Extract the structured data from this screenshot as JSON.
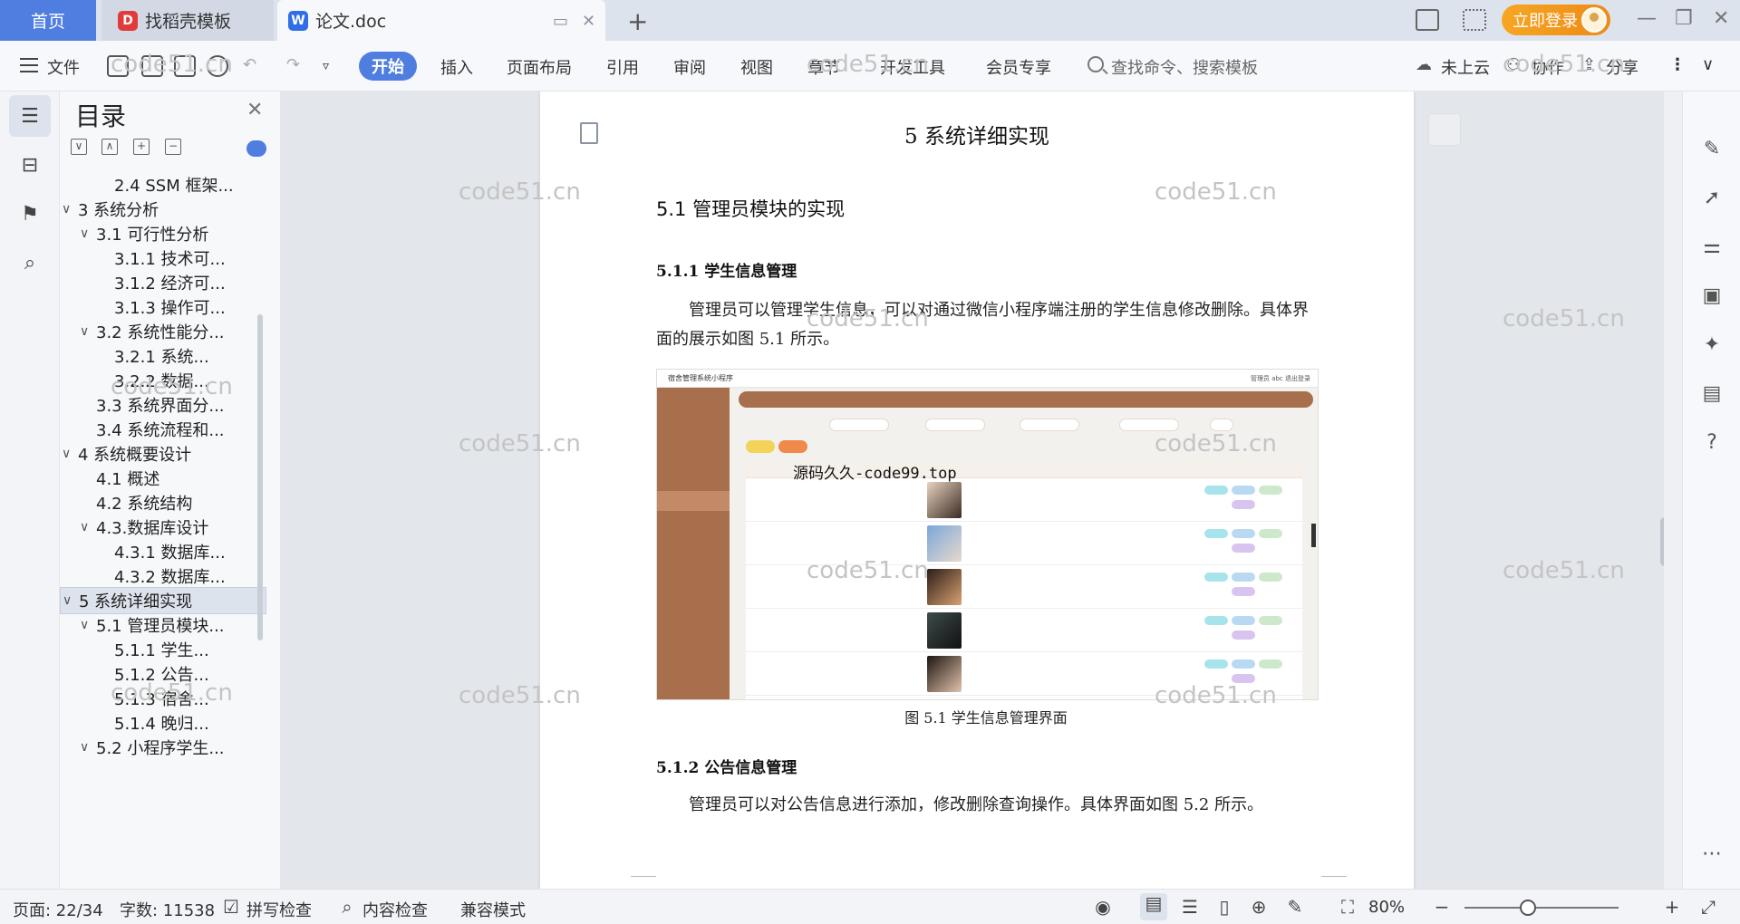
{
  "tabs": {
    "home": "首页",
    "template": "找稻壳模板",
    "doc": "论文.doc",
    "new_tab": "+"
  },
  "account": {
    "login": "立即登录"
  },
  "toolbar": {
    "file": "文件",
    "start": "开始",
    "menus": [
      "插入",
      "页面布局",
      "引用",
      "审阅",
      "视图",
      "章节",
      "开发工具",
      "会员专享"
    ],
    "search_placeholder": "查找命令、搜索模板",
    "cloud": "未上云",
    "collab": "协作",
    "share": "分享"
  },
  "toc": {
    "title": "目录",
    "items": [
      {
        "label": "2.4 SSM 框架...",
        "level": 3,
        "arrow": ""
      },
      {
        "label": "3 系统分析",
        "level": 1,
        "arrow": "∨"
      },
      {
        "label": "3.1 可行性分析",
        "level": 2,
        "arrow": "∨"
      },
      {
        "label": "3.1.1 技术可...",
        "level": 3,
        "arrow": ""
      },
      {
        "label": "3.1.2 经济可...",
        "level": 3,
        "arrow": ""
      },
      {
        "label": "3.1.3 操作可...",
        "level": 3,
        "arrow": ""
      },
      {
        "label": "3.2 系统性能分...",
        "level": 2,
        "arrow": "∨"
      },
      {
        "label": "3.2.1 系统...",
        "level": 3,
        "arrow": ""
      },
      {
        "label": "3.2.2 数据...",
        "level": 3,
        "arrow": ""
      },
      {
        "label": "3.3 系统界面分...",
        "level": 2,
        "arrow": ""
      },
      {
        "label": "3.4 系统流程和...",
        "level": 2,
        "arrow": ""
      },
      {
        "label": "4 系统概要设计",
        "level": 1,
        "arrow": "∨"
      },
      {
        "label": "4.1 概述",
        "level": 2,
        "arrow": ""
      },
      {
        "label": "4.2 系统结构",
        "level": 2,
        "arrow": ""
      },
      {
        "label": "4.3.数据库设计",
        "level": 2,
        "arrow": "∨"
      },
      {
        "label": "4.3.1 数据库...",
        "level": 3,
        "arrow": ""
      },
      {
        "label": "4.3.2 数据库...",
        "level": 3,
        "arrow": ""
      },
      {
        "label": "5 系统详细实现",
        "level": 1,
        "arrow": "∨",
        "selected": true
      },
      {
        "label": "5.1 管理员模块...",
        "level": 2,
        "arrow": "∨"
      },
      {
        "label": "5.1.1 学生...",
        "level": 3,
        "arrow": ""
      },
      {
        "label": "5.1.2 公告...",
        "level": 3,
        "arrow": ""
      },
      {
        "label": "5.1.3 宿舍...",
        "level": 3,
        "arrow": ""
      },
      {
        "label": "5.1.4 晚归...",
        "level": 3,
        "arrow": ""
      },
      {
        "label": "5.2 小程序学生...",
        "level": 2,
        "arrow": "∨"
      }
    ]
  },
  "document": {
    "chapter_title": "5 系统详细实现",
    "section_title": "5.1 管理员模块的实现",
    "sub1_title": "5.1.1 学生信息管理",
    "sub1_para": "　　管理员可以管理学生信息，可以对通过微信小程序端注册的学生信息修改删除。具体界面的展示如图 5.1 所示。",
    "figure_caption": "图 5.1 学生信息管理界面",
    "sub2_title": "5.1.2 公告信息管理",
    "sub2_para": "　　管理员可以对公告信息进行添加，修改删除查询操作。具体界面如图 5.2 所示。",
    "figure": {
      "app_title": "宿舍管理系统小程序",
      "overlay_text": "源码久久-code99.top",
      "user": "管理员 abc 退出登录"
    }
  },
  "watermark": "code51.cn",
  "statusbar": {
    "page": "页面: 22/34",
    "words": "字数: 11538",
    "spell": "拼写检查",
    "content_check": "内容检查",
    "compat": "兼容模式",
    "zoom": "80%",
    "zoom_value_percent": 80
  }
}
